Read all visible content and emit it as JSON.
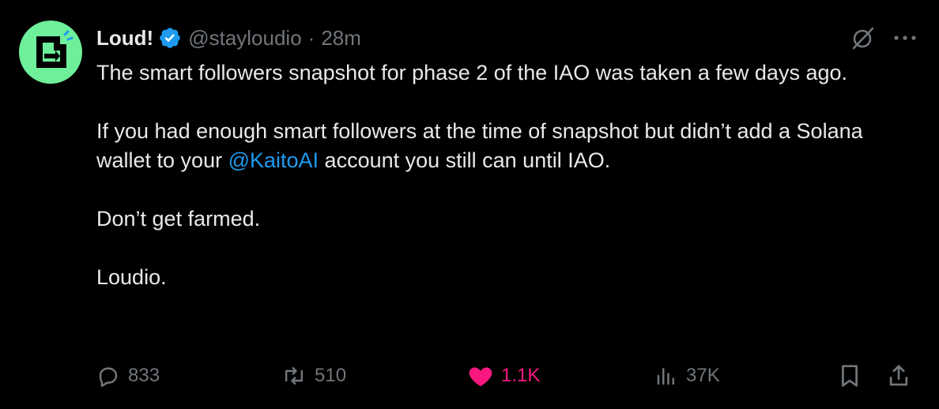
{
  "author": {
    "display_name": "Loud!",
    "handle": "@stayloudio",
    "separator": "·",
    "time": "28m"
  },
  "body": {
    "para1": "The smart followers snapshot for phase 2 of the IAO was taken a few days ago.",
    "para2_before": "If you had enough smart followers at the time of snapshot but didn’t add a Solana wallet to your ",
    "para2_mention": "@KaitoAI",
    "para2_after": " account you still can until IAO.",
    "para3": "Don’t get farmed.",
    "para4": "Loudio."
  },
  "actions": {
    "replies": "833",
    "reposts": "510",
    "likes": "1.1K",
    "views": "37K"
  },
  "icons": {
    "verified": "verified-badge-icon",
    "grok": "grok-icon",
    "more": "more-icon",
    "reply": "reply-icon",
    "repost": "repost-icon",
    "like": "heart-icon",
    "views": "views-icon",
    "bookmark": "bookmark-icon",
    "share": "share-icon"
  },
  "colors": {
    "background": "#000000",
    "text": "#e7e9ea",
    "muted": "#71767b",
    "link": "#1d9bf0",
    "like": "#f91880",
    "avatar_bg": "#6ef09a"
  }
}
